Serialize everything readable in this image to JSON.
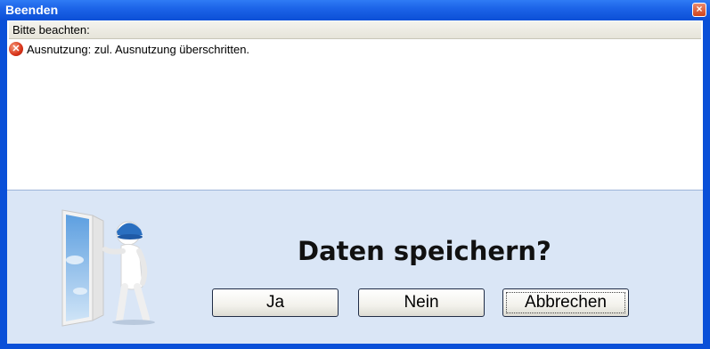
{
  "window": {
    "title": "Beenden",
    "close_glyph": "×"
  },
  "list": {
    "header": "Bitte beachten:",
    "items": [
      {
        "icon": "error-icon",
        "text": "Ausnutzung: zul. Ausnutzung überschritten."
      }
    ]
  },
  "dialog": {
    "question": "Daten speichern?",
    "buttons": {
      "yes": "Ja",
      "no": "Nein",
      "cancel": "Abbrechen"
    }
  },
  "colors": {
    "titlebar": "#0b4fd6",
    "panel": "#dae6f6",
    "error": "#d8341a"
  }
}
